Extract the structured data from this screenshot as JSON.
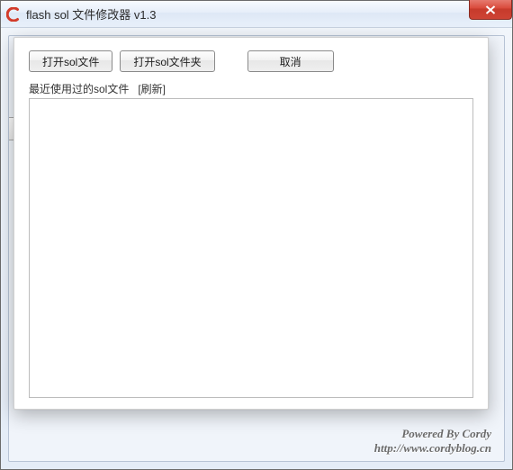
{
  "window": {
    "title": "flash sol 文件修改器 v1.3"
  },
  "dialog": {
    "buttons": {
      "open_file": "打开sol文件",
      "open_folder": "打开sol文件夹",
      "cancel": "取消"
    },
    "recent_label": "最近使用过的sol文件",
    "refresh_label": "[刷新]",
    "recent_items": []
  },
  "footer": {
    "powered_by": "Powered By Cordy",
    "url": "http://www.cordyblog.cn"
  }
}
